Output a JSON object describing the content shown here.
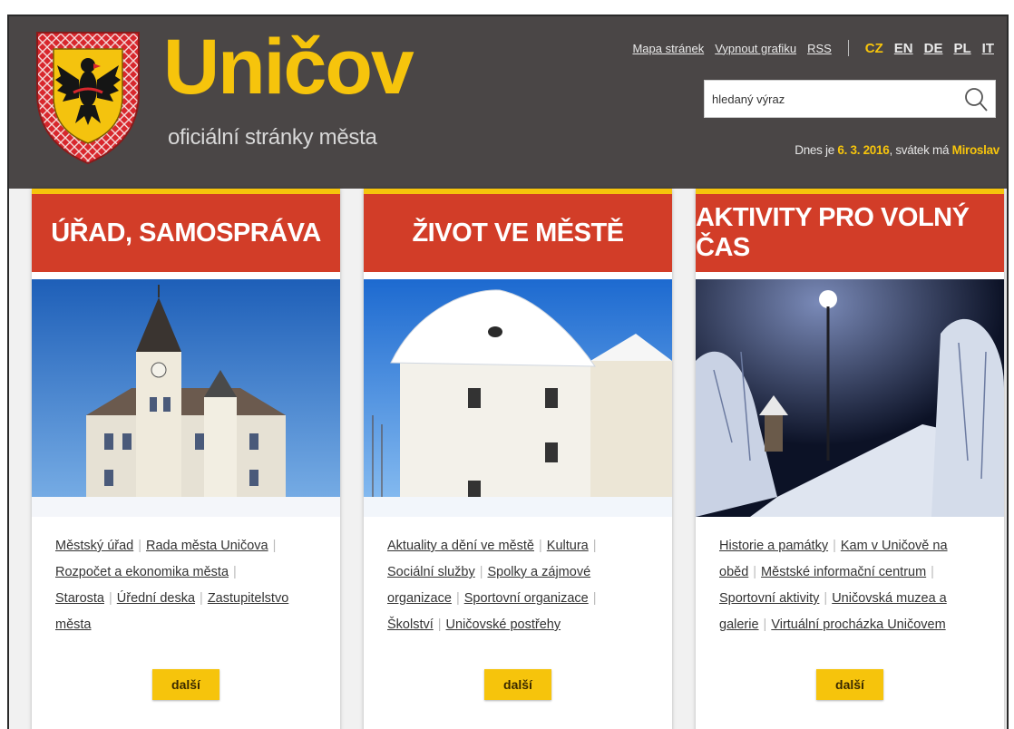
{
  "logo": {
    "title": "Uničov",
    "subtitle": "oficiální stránky města"
  },
  "toplinks": [
    {
      "label": "Mapa stránek"
    },
    {
      "label": "Vypnout grafiku"
    },
    {
      "label": "RSS"
    }
  ],
  "languages": [
    {
      "code": "CZ",
      "active": true
    },
    {
      "code": "EN",
      "active": false
    },
    {
      "code": "DE",
      "active": false
    },
    {
      "code": "PL",
      "active": false
    },
    {
      "code": "IT",
      "active": false
    }
  ],
  "search": {
    "placeholder": "hledaný výraz",
    "icon": "search-icon"
  },
  "dateline": {
    "prefix": "Dnes je ",
    "date": "6. 3. 2016",
    "middle": ", svátek má ",
    "name": "Miroslav"
  },
  "colors": {
    "header": "#4a4646",
    "accent_yellow": "#f6c40c",
    "band_red": "#d23d28"
  },
  "cards": [
    {
      "title": "ÚŘAD, SAMOSPRÁVA",
      "links": [
        "Městský úřad",
        "Rada města Uničova",
        "Rozpočet a ekonomika města",
        "Starosta",
        "Úřední deska",
        "Zastupitelstvo města"
      ],
      "more": "další"
    },
    {
      "title": "ŽIVOT VE MĚSTĚ",
      "links": [
        "Aktuality a dění ve městě",
        "Kultura",
        "Sociální služby",
        "Spolky a zájmové organizace",
        "Sportovní organizace",
        "Školství",
        "Uničovské postřehy"
      ],
      "more": "další"
    },
    {
      "title": "AKTIVITY PRO VOLNÝ ČAS",
      "links": [
        "Historie a památky",
        "Kam v Uničově na oběd",
        "Městské informační centrum",
        "Sportovní aktivity",
        "Uničovská muzea a galerie",
        "Virtuální procházka Uničovem"
      ],
      "more": "další"
    }
  ]
}
